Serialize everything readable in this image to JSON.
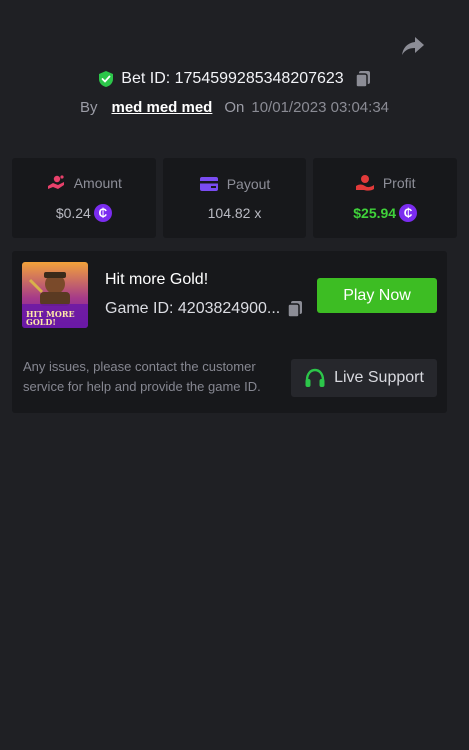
{
  "header": {
    "bet_id_label": "Bet ID: 1754599285348207623",
    "by_label": "By",
    "username": "med med med",
    "on_label": "On",
    "datetime": "10/01/2023 03:04:34"
  },
  "stats": [
    {
      "label": "Amount",
      "value": "$0.24",
      "icon": "amount-icon",
      "coin": "₵"
    },
    {
      "label": "Payout",
      "value": "104.82 x",
      "icon": "card-icon"
    },
    {
      "label": "Profit",
      "value": "$25.94",
      "icon": "profit-icon",
      "coin": "₵"
    }
  ],
  "game": {
    "title": "Hit more Gold!",
    "id_label": "Game ID: 4203824900...",
    "thumb_text": "HIT MORE GOLD!",
    "play_label": "Play Now"
  },
  "support": {
    "help_text": "Any issues, please contact the customer service for help and provide the game ID.",
    "button_label": "Live Support"
  },
  "colors": {
    "background": "#1f2024",
    "panel": "#17181b",
    "accent_green": "#3dbd23",
    "profit_green": "#3fd23a",
    "coin_purple": "#7b2cf0",
    "payout_purple": "#7a4cf2",
    "amount_pink": "#e8416b",
    "profit_red": "#e23a3a"
  }
}
